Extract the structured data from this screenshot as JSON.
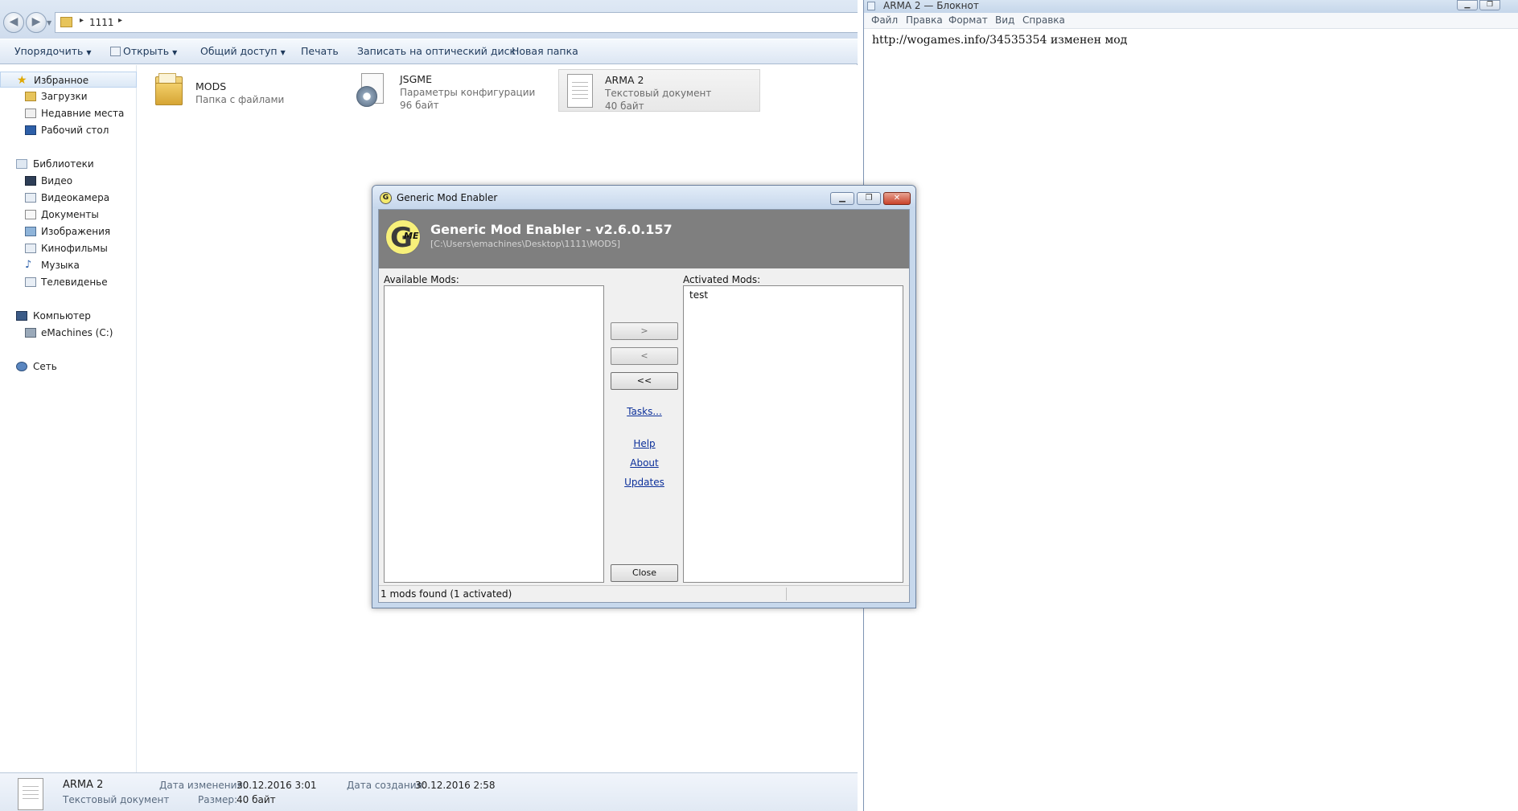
{
  "explorer": {
    "address": {
      "path": "1111",
      "arrow": "▸",
      "back_glyph": "◀",
      "forward_glyph": "▶"
    },
    "toolbar": {
      "organize": "Упорядочить",
      "open": "Открыть",
      "share": "Общий доступ",
      "print": "Печать",
      "burn": "Записать на оптический диск",
      "new_folder": "Новая папка"
    },
    "nav": {
      "favorites": "Избранное",
      "downloads": "Загрузки",
      "recent": "Недавние места",
      "desktop": "Рабочий стол",
      "libraries": "Библиотеки",
      "video": "Видео",
      "camera": "Видеокамера",
      "documents": "Документы",
      "images": "Изображения",
      "movies": "Кинофильмы",
      "music": "Музыка",
      "tv": "Телевиденье",
      "computer": "Компьютер",
      "drive_c": "eMachines (C:)",
      "network": "Сеть"
    },
    "files": [
      {
        "name": "MODS",
        "type": "Папка с файлами",
        "size": "",
        "icon": "folder-icon"
      },
      {
        "name": "JSGME",
        "type": "Параметры конфигурации",
        "size": "96 байт",
        "icon": "config-file-icon"
      },
      {
        "name": "ARMA 2",
        "type": "Текстовый документ",
        "size": "40 байт",
        "icon": "text-file-icon"
      }
    ],
    "details": {
      "name": "ARMA 2",
      "type": "Текстовый документ",
      "modified_label": "Дата изменения:",
      "modified_value": "30.12.2016 3:01",
      "created_label": "Дата создания:",
      "created_value": "30.12.2016 2:58",
      "size_label": "Размер:",
      "size_value": "40 байт"
    }
  },
  "notepad": {
    "title": "ARMA 2 — Блокнот",
    "menu": {
      "file": "Файл",
      "edit": "Правка",
      "format": "Формат",
      "view": "Вид",
      "help": "Справка"
    },
    "text": "http://wogames.info/34535354 изменен мод"
  },
  "gme": {
    "window_title": "Generic Mod Enabler",
    "logo_letter": "G",
    "logo_sub": "ME",
    "header_title": "Generic Mod Enabler - v2.6.0.157",
    "header_path": "[C:\\Users\\emachines\\Desktop\\1111\\MODS]",
    "available_label": "Available Mods:",
    "activated_label": "Activated Mods:",
    "available_mods": [],
    "activated_mods": [
      "test"
    ],
    "btn_activate": ">",
    "btn_deactivate": "<",
    "btn_deactivate_all": "<<",
    "link_tasks": "Tasks...",
    "link_help": "Help",
    "link_about": "About",
    "link_updates": "Updates",
    "btn_close": "Close",
    "status": "1 mods found (1 activated)",
    "titlebar_buttons": {
      "minimize": "▁",
      "maximize": "❐",
      "close": "✕"
    }
  },
  "colors": {
    "gme_header_bg": "#7f7f7f",
    "gme_logo": "#f7f07a",
    "link": "#0b2f9a",
    "explorer_toolbar": "#dce6f3"
  }
}
